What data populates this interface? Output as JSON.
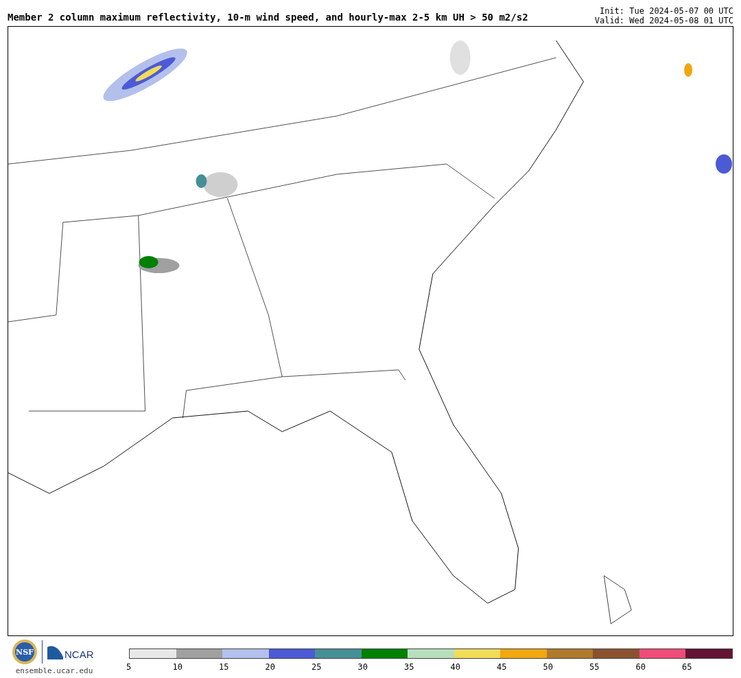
{
  "header": {
    "title": "Member 2 column maximum reflectivity, 10-m wind speed, and hourly-max 2-5 km UH > 50 m2/s2",
    "init": "Init: Tue 2024-05-07 00 UTC",
    "valid": "Valid: Wed 2024-05-08 01 UTC"
  },
  "logos": {
    "nsf": "NSF",
    "ncar": "NCAR",
    "site": "ensemble.ucar.edu"
  },
  "colorbar": [
    {
      "label": "5",
      "color": "#e8e8e8"
    },
    {
      "label": "10",
      "color": "#a0a0a0"
    },
    {
      "label": "15",
      "color": "#b3c0ec"
    },
    {
      "label": "20",
      "color": "#4c5ad6"
    },
    {
      "label": "25",
      "color": "#458f96"
    },
    {
      "label": "30",
      "color": "#008000"
    },
    {
      "label": "35",
      "color": "#b7dfbd"
    },
    {
      "label": "40",
      "color": "#f0db5a"
    },
    {
      "label": "45",
      "color": "#f0a710"
    },
    {
      "label": "50",
      "color": "#b07a2c"
    },
    {
      "label": "55",
      "color": "#8a5230"
    },
    {
      "label": "60",
      "color": "#ef4c7a"
    },
    {
      "label": "65",
      "color": "#621435"
    }
  ]
}
